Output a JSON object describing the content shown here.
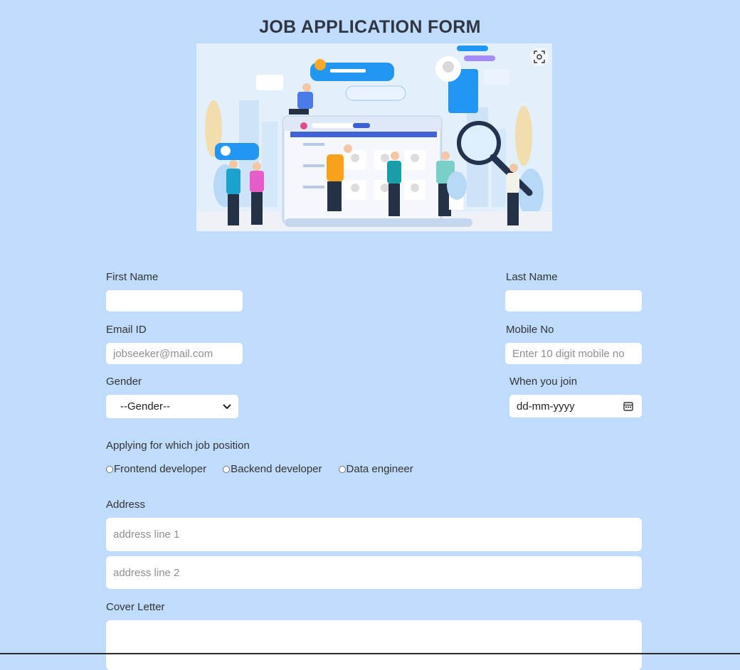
{
  "page": {
    "title": "JOB APPLICATION FORM"
  },
  "form": {
    "first_name": {
      "label": "First Name",
      "value": "",
      "placeholder": ""
    },
    "last_name": {
      "label": "Last Name",
      "value": "",
      "placeholder": ""
    },
    "email": {
      "label": "Email ID",
      "value": "",
      "placeholder": "jobseeker@mail.com"
    },
    "mobile": {
      "label": "Mobile No",
      "value": "",
      "placeholder": "Enter 10 digit mobile no"
    },
    "gender": {
      "label": "Gender",
      "selected": "--Gender--"
    },
    "join_date": {
      "label": "When you join",
      "value": "dd-mm-yyyy"
    },
    "position": {
      "label": "Applying for which job position",
      "options": [
        "Frontend developer",
        "Backend developer",
        "Data engineer"
      ]
    },
    "address": {
      "label": "Address",
      "line1_placeholder": "address line 1",
      "line2_placeholder": "address line 2"
    },
    "cover_letter": {
      "label": "Cover Letter",
      "value": ""
    }
  },
  "icons": {
    "visual_search": "scan-icon",
    "select_arrow": "chevron-down-icon",
    "calendar": "calendar-icon"
  },
  "colors": {
    "background": "#bfdcfd",
    "field": "#ffffff",
    "title": "#2f3642"
  }
}
